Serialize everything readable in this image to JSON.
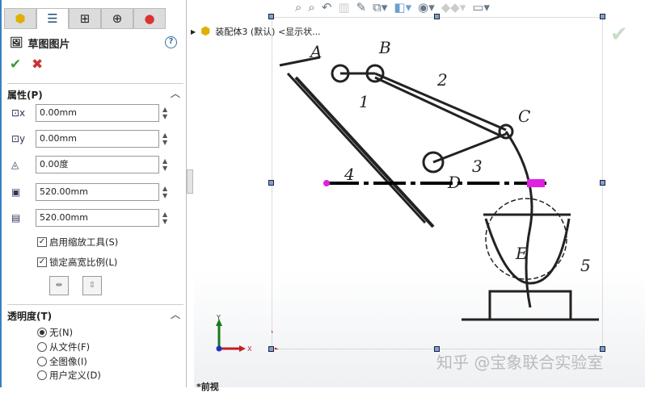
{
  "panel": {
    "tabs": [
      "feature-manager",
      "property-manager",
      "configuration-manager",
      "dimxpert-manager",
      "display-manager"
    ],
    "title": "草图图片",
    "help": "?",
    "ok": "✔",
    "cancel": "✖",
    "properties": {
      "header": "属性(P)",
      "x": "0.00mm",
      "y": "0.00mm",
      "angle": "0.00度",
      "width": "520.00mm",
      "height": "520.00mm",
      "enable_scale": "启用缩放工具(S)",
      "lock_ratio": "锁定高宽比例(L)"
    },
    "transparency": {
      "header": "透明度(T)",
      "options": [
        "无(N)",
        "从文件(F)",
        "全图像(I)",
        "用户定义(D)"
      ],
      "selected": 0
    }
  },
  "viewport": {
    "tree_item": "装配体3 (默认) <显示状...",
    "view_label": "*前视",
    "axis_x": "X",
    "axis_y": "Y",
    "watermark": "知乎 @宝象联合实验室",
    "figure_labels": [
      "A",
      "B",
      "C",
      "D",
      "E",
      "1",
      "2",
      "3",
      "4",
      "5"
    ]
  }
}
